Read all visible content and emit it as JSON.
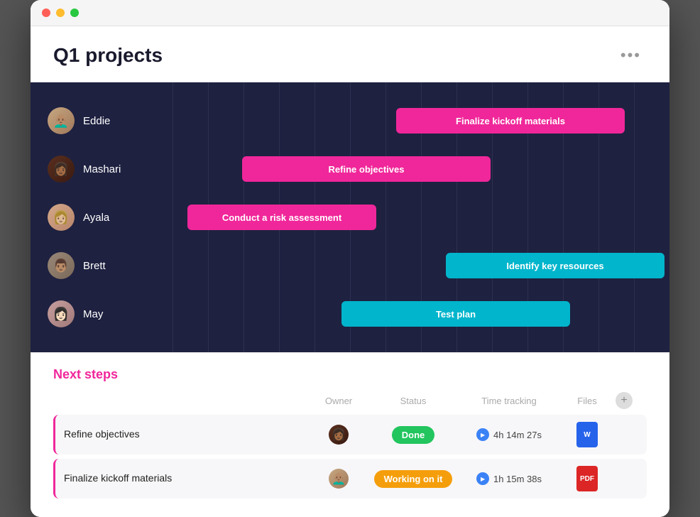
{
  "window": {
    "title": "Q1 projects"
  },
  "header": {
    "title": "Q1 projects",
    "more_label": "•••"
  },
  "gantt": {
    "people": [
      {
        "id": "eddie",
        "name": "Eddie",
        "emoji": "👨🏽‍🦲",
        "bar_label": "Finalize kickoff materials",
        "bar_color": "pink"
      },
      {
        "id": "mashari",
        "name": "Mashari",
        "emoji": "👩🏾",
        "bar_label": "Refine objectives",
        "bar_color": "pink"
      },
      {
        "id": "ayala",
        "name": "Ayala",
        "emoji": "👩🏼",
        "bar_label": "Conduct a risk assessment",
        "bar_color": "pink"
      },
      {
        "id": "brett",
        "name": "Brett",
        "emoji": "👨🏽",
        "bar_label": "Identify key resources",
        "bar_color": "cyan"
      },
      {
        "id": "may",
        "name": "May",
        "emoji": "👩🏻",
        "bar_label": "Test plan",
        "bar_color": "cyan"
      }
    ]
  },
  "next_steps": {
    "title": "Next steps",
    "columns": {
      "owner": "Owner",
      "status": "Status",
      "time_tracking": "Time tracking",
      "files": "Files"
    },
    "tasks": [
      {
        "name": "Refine objectives",
        "owner_emoji": "👩🏾",
        "status": "Done",
        "status_type": "done",
        "time": "4h 14m 27s",
        "file_type": "word",
        "file_label": "W"
      },
      {
        "name": "Finalize kickoff materials",
        "owner_emoji": "👨🏽‍🦲",
        "status": "Working on it",
        "status_type": "working",
        "time": "1h 15m 38s",
        "file_type": "pdf",
        "file_label": "PDF"
      }
    ]
  }
}
